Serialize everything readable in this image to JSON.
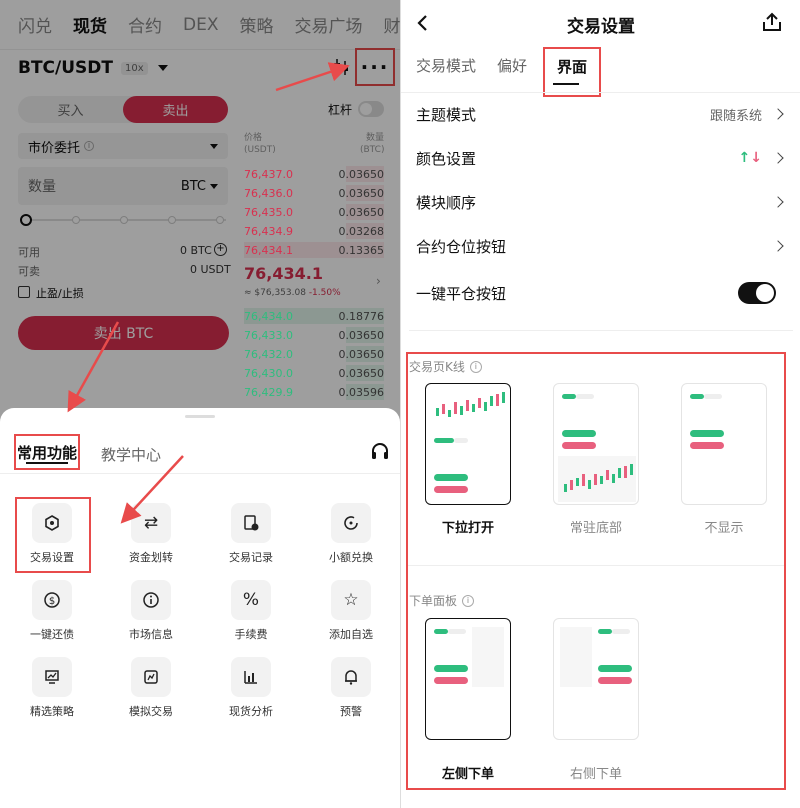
{
  "left": {
    "top_nav": [
      "闪兑",
      "现货",
      "合约",
      "DEX",
      "策略",
      "交易广场",
      "财"
    ],
    "active_nav": "现货",
    "pair": "BTC/USDT",
    "leverage_badge": "10x",
    "buy_label": "买入",
    "sell_label": "卖出",
    "leverage_label": "杠杆",
    "order_type": "市价委托",
    "qty_label": "数量",
    "qty_unit": "BTC",
    "available_label": "可用",
    "available_value": "0 BTC",
    "sellable_label": "可卖",
    "sellable_value": "0 USDT",
    "tp_sl_label": "止盈/止损",
    "sell_button": "卖出 BTC",
    "orderbook": {
      "price_header": "价格",
      "price_unit": "(USDT)",
      "qty_header": "数量",
      "qty_unit": "(BTC)",
      "asks": [
        {
          "price": "76,437.0",
          "qty": "0.03650"
        },
        {
          "price": "76,436.0",
          "qty": "0.03650"
        },
        {
          "price": "76,435.0",
          "qty": "0.03650"
        },
        {
          "price": "76,434.9",
          "qty": "0.03268"
        },
        {
          "price": "76,434.1",
          "qty": "0.13365"
        }
      ],
      "mid_price": "76,434.1",
      "mid_usd": "≈ $76,353.08",
      "mid_change": "-1.50%",
      "bids": [
        {
          "price": "76,434.0",
          "qty": "0.18776"
        },
        {
          "price": "76,433.0",
          "qty": "0.03650"
        },
        {
          "price": "76,432.0",
          "qty": "0.03650"
        },
        {
          "price": "76,430.0",
          "qty": "0.03650"
        },
        {
          "price": "76,429.9",
          "qty": "0.03596"
        }
      ]
    },
    "sheet": {
      "tab_active": "常用功能",
      "tab_other": "教学中心",
      "items": [
        {
          "label": "交易设置",
          "icon": "hexagon-icon"
        },
        {
          "label": "资金划转",
          "icon": "transfer-icon"
        },
        {
          "label": "交易记录",
          "icon": "record-icon"
        },
        {
          "label": "小额兑换",
          "icon": "convert-icon"
        },
        {
          "label": "一键还债",
          "icon": "repay-icon"
        },
        {
          "label": "市场信息",
          "icon": "info-icon"
        },
        {
          "label": "手续费",
          "icon": "percent-icon"
        },
        {
          "label": "添加自选",
          "icon": "star-icon"
        },
        {
          "label": "精选策略",
          "icon": "strategy-icon"
        },
        {
          "label": "模拟交易",
          "icon": "demo-icon"
        },
        {
          "label": "现货分析",
          "icon": "chart-icon"
        },
        {
          "label": "预警",
          "icon": "bell-icon"
        }
      ]
    }
  },
  "right": {
    "title": "交易设置",
    "tabs": [
      "交易模式",
      "偏好",
      "界面"
    ],
    "active_tab": "界面",
    "rows": [
      {
        "label": "主题模式",
        "value": "跟随系统"
      },
      {
        "label": "颜色设置",
        "value": "↑↓"
      },
      {
        "label": "模块顺序",
        "value": ""
      },
      {
        "label": "合约仓位按钮",
        "value": ""
      },
      {
        "label": "一键平仓按钮",
        "value": ""
      }
    ],
    "kline_section": "交易页K线",
    "kline_options": [
      "下拉打开",
      "常驻底部",
      "不显示"
    ],
    "order_section": "下单面板",
    "order_options": [
      "左侧下单",
      "右侧下单"
    ]
  },
  "colors": {
    "accent": "#e84b4b",
    "sell": "#d9304f",
    "buy": "#2ebd7e"
  }
}
